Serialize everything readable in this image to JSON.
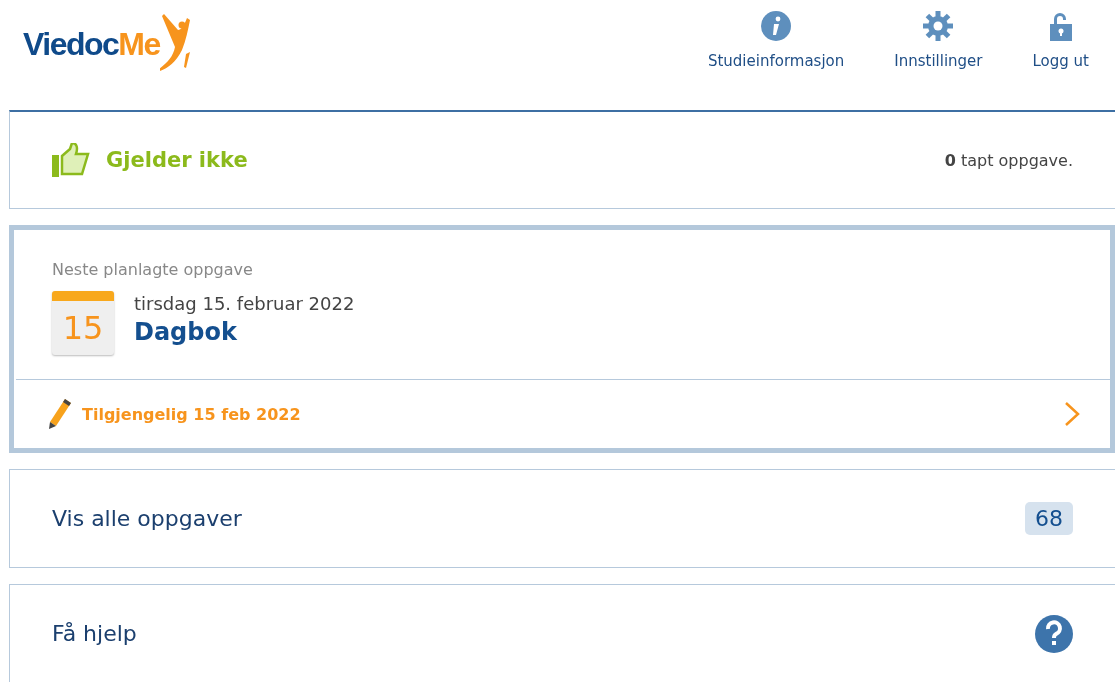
{
  "logo": {
    "part_1": "Viedoc",
    "part_2": "Me"
  },
  "nav": [
    {
      "kind": "info",
      "label": "Studieinformasjon"
    },
    {
      "kind": "settings",
      "label": "Innstillinger"
    },
    {
      "kind": "logout",
      "label": "Logg ut"
    }
  ],
  "status": {
    "label": "Gjelder ikke",
    "missed": "**0** tapt oppgave."
  },
  "next_task": {
    "heading": "Neste planlagte oppgave",
    "calendar_day": "15",
    "date": "tirsdag 15. februar 2022",
    "title": "Dagbok",
    "available": "Tilgjengelig 15 feb 2022"
  },
  "links": [
    {
      "kind": "count",
      "label": "Vis alle oppgaver",
      "count": "68"
    },
    {
      "kind": "help",
      "label": "Få hjelp"
    }
  ]
}
